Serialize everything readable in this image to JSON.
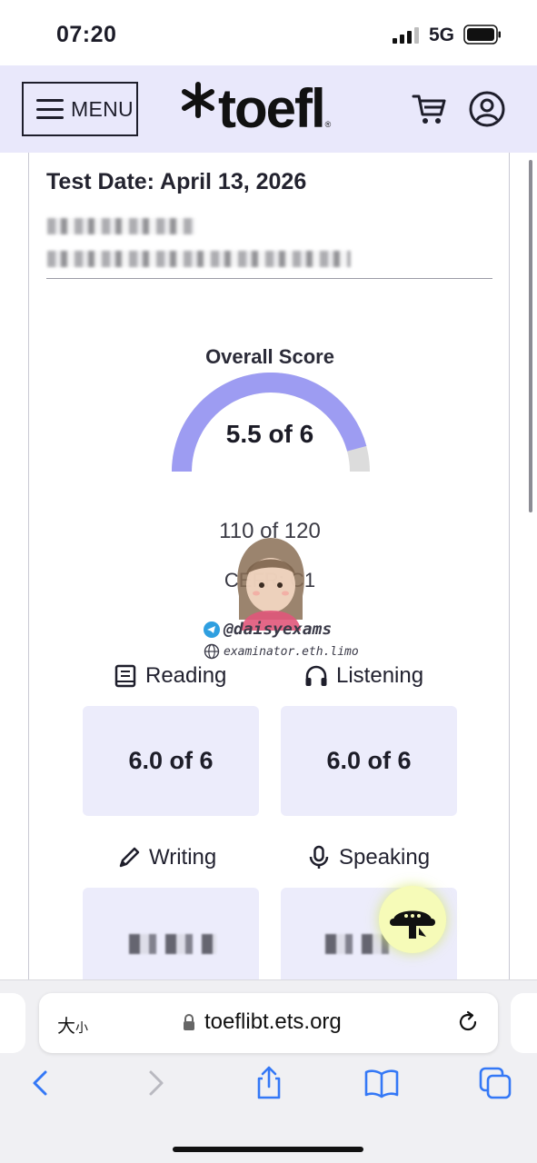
{
  "status_bar": {
    "time": "07:20",
    "network": "5G"
  },
  "header": {
    "menu_label": "MENU",
    "logo_text": "toefl"
  },
  "report": {
    "test_date": "Test Date: April 13, 2026",
    "overall_label": "Overall Score",
    "overall_value": "5.5 of 6",
    "overall_fraction": 0.917,
    "total_score": "110 of 120",
    "cefr": "CEFR: C1"
  },
  "watermark": {
    "telegram": "@daisyexams",
    "website": "examinator.eth.limo"
  },
  "sections": {
    "reading": {
      "label": "Reading",
      "score": "6.0 of 6"
    },
    "listening": {
      "label": "Listening",
      "score": "6.0 of 6"
    },
    "writing": {
      "label": "Writing"
    },
    "speaking": {
      "label": "Speaking"
    }
  },
  "browser": {
    "text_size_label": "大",
    "text_size_small": "小",
    "url": "toeflibt.ets.org"
  },
  "colors": {
    "header_bg": "#e9e8fb",
    "gauge_fill": "#9d9cf2",
    "gauge_track": "#dcdcdc",
    "score_box_bg": "#ececfb"
  }
}
